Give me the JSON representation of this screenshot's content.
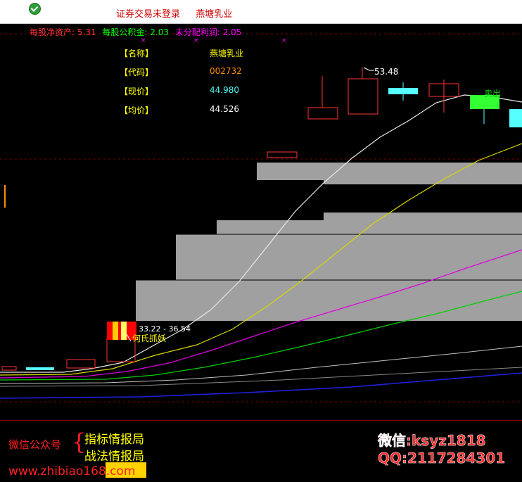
{
  "window": {
    "title_status": "证券交易未登录",
    "title_stock": "燕塘乳业",
    "icon": "green-check-icon"
  },
  "financials": {
    "nav_label": "每股净资产:",
    "nav_value": "5.31",
    "reserve_label": "每股公积金:",
    "reserve_value": "2.03",
    "undist_label": "未分配利润:",
    "undist_value": "2.05"
  },
  "info_panel": {
    "name_key": "【名称】",
    "name_value": "燕塘乳业",
    "code_key": "【代码】",
    "code_value": "002732",
    "price_key": "【现价】",
    "price_value": "44.980",
    "avg_key": "【均价】",
    "avg_value": "44.526"
  },
  "chart_labels": {
    "high_price": "53.48",
    "range": "33.22 - 36.54",
    "signal": "何氏抓妖",
    "sell_signal": "卖出"
  },
  "footer": {
    "wechat_public": "微信公众号",
    "brace": "{",
    "line1": "指标情报局",
    "line2": "战法情报局",
    "website": "www.zhibiao168.com",
    "wechat_contact": "微信:ksyz1818",
    "qq_contact": "QQ:2117284301"
  },
  "colors": {
    "background": "#000000",
    "up_candle": "#ff3333",
    "down_candle": "#55ffff",
    "volume_bar": "#a0a0a0",
    "ma_white": "#ffffff",
    "ma_yellow": "#ffff00",
    "ma_magenta": "#ff00ff",
    "ma_green": "#00ff00",
    "ma_blue": "#0000ff"
  }
}
